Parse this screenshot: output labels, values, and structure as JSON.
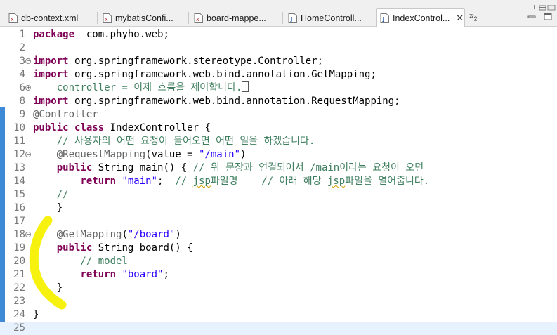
{
  "tabs": [
    {
      "label": "db-context.xml",
      "type": "xml",
      "active": false
    },
    {
      "label": "mybatisConfi...",
      "type": "xml",
      "active": false
    },
    {
      "label": "board-mappe...",
      "type": "xml",
      "active": false
    },
    {
      "label": "HomeControll...",
      "type": "java",
      "active": false
    },
    {
      "label": "IndexControl...",
      "type": "java",
      "active": true
    }
  ],
  "overflow": {
    "chevron": "»",
    "count": "2"
  },
  "colors": {
    "keyword": "#7f0055",
    "comment": "#3f7f5f",
    "string": "#2a00ff",
    "annotation": "#646464",
    "change_bar": "#3f8ad7",
    "highlighter": "#f5f000"
  },
  "editor": {
    "lines": [
      {
        "n": "1",
        "tokens": [
          [
            "kw",
            "package"
          ],
          [
            "",
            "  com.phyho.web;"
          ]
        ]
      },
      {
        "n": "2",
        "tokens": []
      },
      {
        "n": "3",
        "fold": "minus",
        "tokens": [
          [
            "kw",
            "import"
          ],
          [
            "",
            " org.springframework.stereotype.Controller;"
          ]
        ]
      },
      {
        "n": "4",
        "tokens": [
          [
            "kw",
            "import"
          ],
          [
            "",
            " org.springframework.web.bind.annotation.GetMapping;"
          ]
        ]
      },
      {
        "n": "6",
        "fold": "plus",
        "tokens": [
          [
            "cm",
            "    controller = 이제 흐름을 제어합니다."
          ],
          [
            "box",
            ""
          ]
        ]
      },
      {
        "n": "8",
        "tokens": [
          [
            "kw",
            "import"
          ],
          [
            "",
            " org.springframework.web.bind.annotation.RequestMapping;"
          ]
        ]
      },
      {
        "n": "9",
        "tokens": [
          [
            "an",
            "@Controller"
          ]
        ]
      },
      {
        "n": "10",
        "tokens": [
          [
            "kw",
            "public"
          ],
          [
            "",
            " "
          ],
          [
            "kw",
            "class"
          ],
          [
            "",
            " IndexController {"
          ]
        ]
      },
      {
        "n": "11",
        "tokens": [
          [
            "cm",
            "    // 사용자의 어떤 요청이 들어오면 어떤 일을 하겠습니다."
          ]
        ]
      },
      {
        "n": "12",
        "fold": "minus",
        "tokens": [
          [
            "an",
            "    @RequestMapping"
          ],
          [
            "",
            "(value = "
          ],
          [
            "st",
            "\"/main\""
          ],
          [
            "",
            ")"
          ]
        ]
      },
      {
        "n": "13",
        "tokens": [
          [
            "",
            "    "
          ],
          [
            "kw",
            "public"
          ],
          [
            "",
            " String main() { "
          ],
          [
            "cm",
            "// 위 문장과 연결되어서 /main이라는 요청이 오면"
          ]
        ]
      },
      {
        "n": "14",
        "tokens": [
          [
            "",
            "        "
          ],
          [
            "kw",
            "return"
          ],
          [
            "",
            " "
          ],
          [
            "st",
            "\"main\""
          ],
          [
            "",
            ";  "
          ],
          [
            "cm",
            "// "
          ],
          [
            "jsp",
            "jsp"
          ],
          [
            "cm",
            "파일명    // 아래 해당 "
          ],
          [
            "jsp",
            "jsp"
          ],
          [
            "cm",
            "파일을 열어줍니다."
          ]
        ]
      },
      {
        "n": "15",
        "tokens": [
          [
            "cm",
            "    //"
          ]
        ]
      },
      {
        "n": "16",
        "tokens": [
          [
            "",
            "    }"
          ]
        ]
      },
      {
        "n": "17",
        "tokens": []
      },
      {
        "n": "18",
        "fold": "minus",
        "tokens": [
          [
            "an",
            "    @GetMapping"
          ],
          [
            "",
            "("
          ],
          [
            "st",
            "\"/board\""
          ],
          [
            "",
            ")"
          ]
        ]
      },
      {
        "n": "19",
        "tokens": [
          [
            "",
            "    "
          ],
          [
            "kw",
            "public"
          ],
          [
            "",
            " String board() {"
          ]
        ]
      },
      {
        "n": "20",
        "tokens": [
          [
            "cm",
            "        // model"
          ]
        ]
      },
      {
        "n": "21",
        "tokens": [
          [
            "",
            "        "
          ],
          [
            "kw",
            "return"
          ],
          [
            "",
            " "
          ],
          [
            "st",
            "\"board\""
          ],
          [
            "",
            ";"
          ]
        ]
      },
      {
        "n": "22",
        "tokens": [
          [
            "",
            "    }"
          ]
        ]
      },
      {
        "n": "23",
        "tokens": []
      },
      {
        "n": "24",
        "tokens": [
          [
            "",
            "}"
          ]
        ]
      },
      {
        "n": "25",
        "current": true,
        "tokens": []
      }
    ]
  }
}
